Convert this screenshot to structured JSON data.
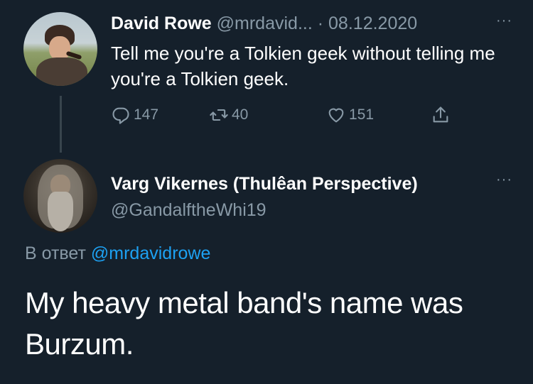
{
  "tweet1": {
    "author_name": "David Rowe",
    "handle": "@mrdavid...",
    "separator": "·",
    "date": "08.12.2020",
    "more": "···",
    "text": "Tell me you're a Tolkien geek without telling me you're a Tolkien geek.",
    "replies": "147",
    "retweets": "40",
    "likes": "151"
  },
  "tweet2": {
    "author_name": "Varg Vikernes (Thulêan Perspective)",
    "handle": "@GandalftheWhi19",
    "more": "···",
    "reply_prefix": "В ответ",
    "reply_mention": "@mrdavidrowe",
    "text": "My heavy metal band's name was Burzum."
  },
  "colors": {
    "background": "#15202b",
    "secondary_text": "#8899a6",
    "link": "#1da1f2",
    "thread_line": "#38444d"
  },
  "icons": [
    "reply-icon",
    "retweet-icon",
    "like-icon",
    "share-icon"
  ]
}
